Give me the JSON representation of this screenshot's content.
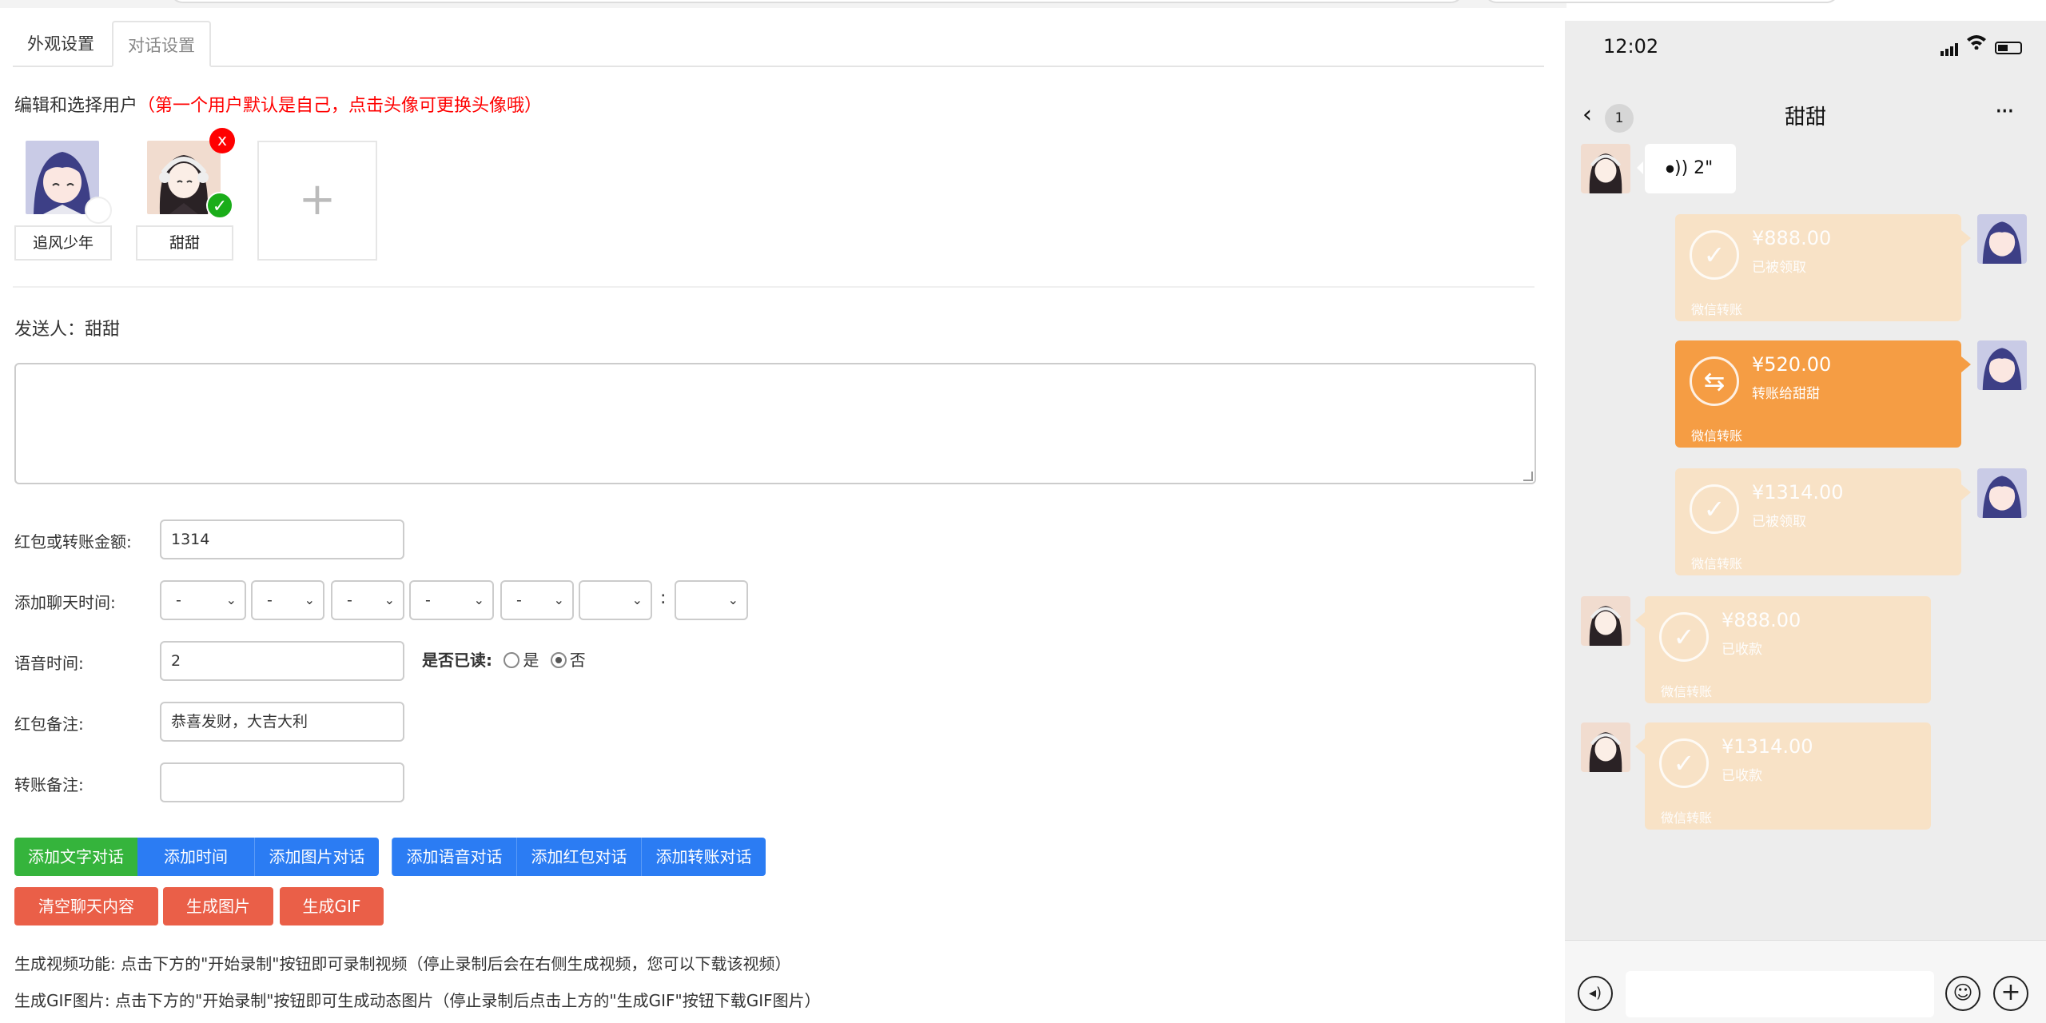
{
  "tabs": [
    "外观设置",
    "对话设置"
  ],
  "section_title": {
    "main": "编辑和选择用户",
    "hint": "（第一个用户默认是自己，点击头像可更换头像哦）"
  },
  "users": [
    {
      "name": "追风少年",
      "selected": false
    },
    {
      "name": "甜甜",
      "selected": true
    }
  ],
  "delete_badge": "x",
  "add_user": "+",
  "sender": "发送人：甜甜",
  "form": {
    "amount_label": "红包或转账金额:",
    "amount_value": "1314",
    "time_label": "添加聊天时间:",
    "time_selects": [
      "-",
      "-",
      "-",
      "-",
      "-",
      "",
      ""
    ],
    "time_colon": ":",
    "voice_label": "语音时间:",
    "voice_value": "2",
    "read_label": "是否已读:",
    "read_yes": "是",
    "read_no": "否",
    "read_selected": "否",
    "redpacket_note_label": "红包备注:",
    "redpacket_note_value": "恭喜发财，大吉大利",
    "transfer_note_label": "转账备注:",
    "transfer_note_value": ""
  },
  "buttons_row1": [
    "添加文字对话",
    "添加时间",
    "添加图片对话",
    "添加语音对话",
    "添加红包对话",
    "添加转账对话"
  ],
  "buttons_row2": [
    "清空聊天内容",
    "生成图片",
    "生成GIF"
  ],
  "info_video": "生成视频功能: 点击下方的\"开始录制\"按钮即可录制视频（停止录制后会在右侧生成视频，您可以下载该视频）",
  "info_gif": "生成GIF图片: 点击下方的\"开始录制\"按钮即可生成动态图片（停止录制后点击上方的\"生成GIF\"按钮下载GIF图片）",
  "phone": {
    "time": "12:02",
    "unread": "1",
    "chat_title": "甜甜",
    "more": "···",
    "messages": [
      {
        "type": "voice",
        "side": "left",
        "text": "2\""
      },
      {
        "type": "transfer",
        "side": "right",
        "state": "done",
        "amount": "¥888.00",
        "sub": "已被领取",
        "footer": "微信转账"
      },
      {
        "type": "transfer",
        "side": "right",
        "state": "active",
        "amount": "¥520.00",
        "sub": "转账给甜甜",
        "footer": "微信转账"
      },
      {
        "type": "transfer",
        "side": "right",
        "state": "done",
        "amount": "¥1314.00",
        "sub": "已被领取",
        "footer": "微信转账"
      },
      {
        "type": "transfer",
        "side": "left",
        "state": "done",
        "amount": "¥888.00",
        "sub": "已收款",
        "footer": "微信转账"
      },
      {
        "type": "transfer",
        "side": "left",
        "state": "done",
        "amount": "¥1314.00",
        "sub": "已收款",
        "footer": "微信转账"
      }
    ]
  },
  "colors": {
    "green": "#35b43c",
    "blue": "#2b7cf3",
    "red": "#ea5f48",
    "transfer_orange": "#f59d44",
    "transfer_done": "#f8e2c6"
  }
}
